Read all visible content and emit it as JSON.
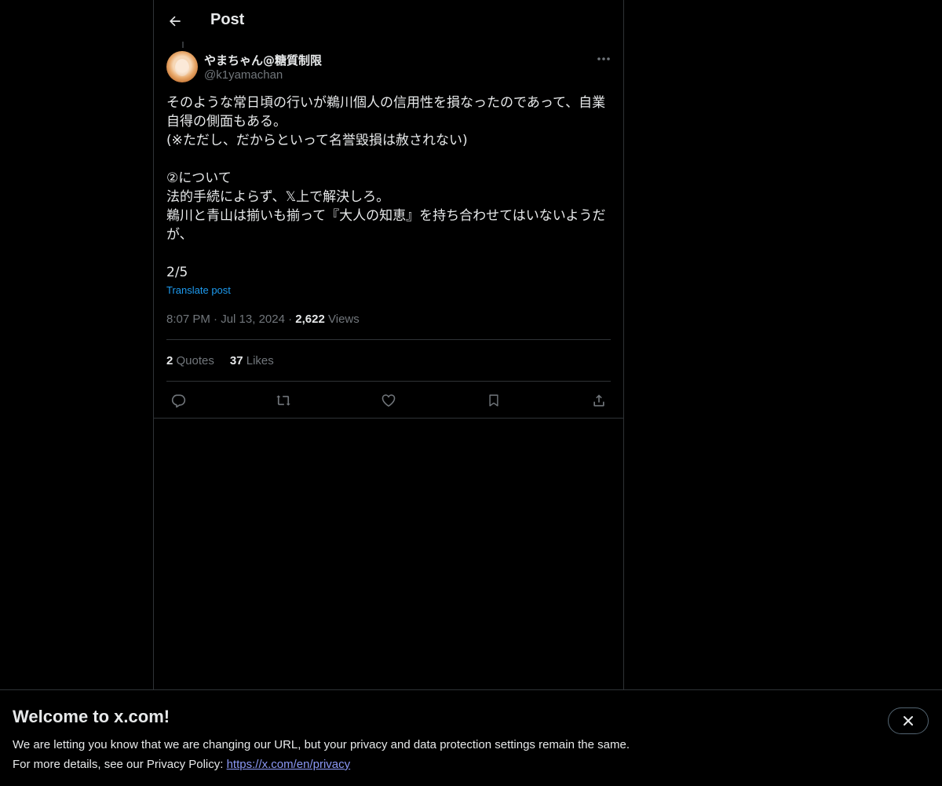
{
  "header": {
    "title": "Post"
  },
  "author": {
    "display_name": "やまちゃん@糖質制限",
    "handle": "@k1yamachan"
  },
  "post": {
    "text": "そのような常日頃の行いが鵜川個人の信用性を損なったのであって、自業\n自得の側面もある。\n(※ただし、だからといって名誉毀損は赦されない)\n\n②について\n法的手続によらず、𝕏上で解決しろ。\n鵜川と青山は揃いも揃って『大人の知恵』を持ち合わせてはいないようだ\nが、\n\n2/5",
    "translate_label": "Translate post",
    "time": "8:07 PM",
    "date": "Jul 13, 2024",
    "separator": "·",
    "views_count": "2,622",
    "views_label": "Views"
  },
  "stats": {
    "quotes_count": "2",
    "quotes_label": "Quotes",
    "likes_count": "37",
    "likes_label": "Likes"
  },
  "icons": {
    "back": "arrow-left-icon",
    "more": "more-horizontal-icon",
    "reply": "reply-icon",
    "repost": "repost-icon",
    "like": "heart-icon",
    "bookmark": "bookmark-icon",
    "share": "share-icon",
    "close": "close-icon"
  },
  "colors": {
    "background": "#000000",
    "text": "#e7e9ea",
    "secondary": "#71767b",
    "accent": "#1d9bf0",
    "border": "#2f3336"
  },
  "banner": {
    "title": "Welcome to x.com!",
    "line1": "We are letting you know that we are changing our URL, but your privacy and data protection settings remain the same.",
    "line2_prefix": "For more details, see our Privacy Policy: ",
    "link": "https://x.com/en/privacy"
  }
}
